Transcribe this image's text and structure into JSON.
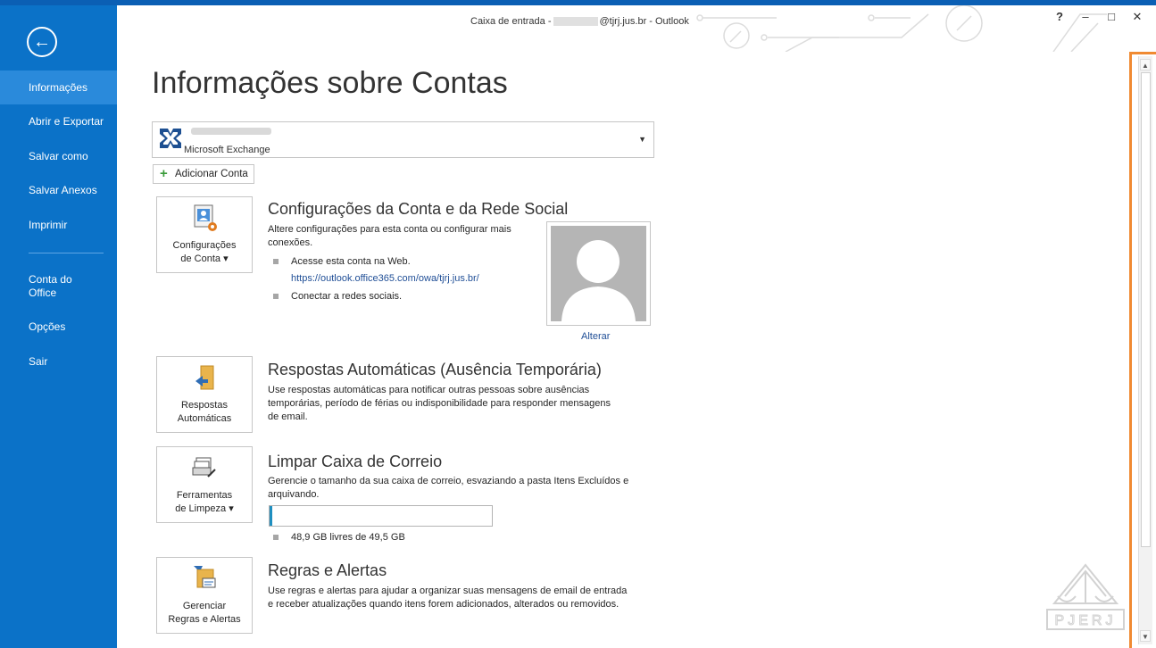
{
  "window": {
    "title_prefix": "Caixa de entrada -",
    "title_suffix": "@tjrj.jus.br - Outlook",
    "help": "?",
    "minimize": "–",
    "maximize": "□",
    "close": "✕"
  },
  "sidebar": {
    "items": [
      {
        "label": "Informações",
        "active": true
      },
      {
        "label": "Abrir e Exportar"
      },
      {
        "label": "Salvar como"
      },
      {
        "label": "Salvar Anexos"
      },
      {
        "label": "Imprimir"
      },
      {
        "label_line1": "Conta do",
        "label_line2": "Office"
      },
      {
        "label": "Opções"
      },
      {
        "label": "Sair"
      }
    ]
  },
  "main": {
    "title": "Informações sobre Contas",
    "account": {
      "type": "Microsoft Exchange"
    },
    "add_account": "Adicionar Conta",
    "sections": {
      "account_settings": {
        "button_line1": "Configurações",
        "button_line2": "de Conta ▾",
        "title": "Configurações da Conta e da Rede Social",
        "description_line1": "Altere configurações para esta conta ou configurar mais",
        "description_line2": "conexões.",
        "bullet1": "Acesse esta conta na Web.",
        "link": "https://outlook.office365.com/owa/tjrj.jus.br/",
        "bullet2": "Conectar a redes sociais.",
        "change_photo": "Alterar"
      },
      "auto_replies": {
        "button_line1": "Respostas",
        "button_line2": "Automáticas",
        "title": "Respostas Automáticas (Ausência Temporária)",
        "description_line1": "Use respostas automáticas para notificar outras pessoas sobre ausências",
        "description_line2": "temporárias, período de férias ou indisponibilidade para responder mensagens",
        "description_line3": "de email."
      },
      "cleanup": {
        "button_line1": "Ferramentas",
        "button_line2": "de Limpeza ▾",
        "title": "Limpar Caixa de Correio",
        "description_line1": "Gerencie o tamanho da sua caixa de correio, esvaziando a pasta Itens Excluídos e",
        "description_line2": "arquivando.",
        "storage_text": "48,9 GB livres de 49,5 GB",
        "used_fraction": 0.012
      },
      "rules": {
        "button_line1": "Gerenciar",
        "button_line2": "Regras e Alertas",
        "title": "Regras e Alertas",
        "description_line1": "Use regras e alertas para ajudar a organizar suas mensagens de email de entrada",
        "description_line2": "e receber atualizações quando itens forem adicionados, alterados ou removidos."
      }
    }
  },
  "watermark": {
    "text": "PJERJ"
  },
  "colors": {
    "sidebar": "#0b72c8",
    "sidebar_active": "#2a8adb",
    "link": "#1f4e96",
    "highlight": "#f08a32",
    "progress_fill": "#1f8fc0"
  }
}
